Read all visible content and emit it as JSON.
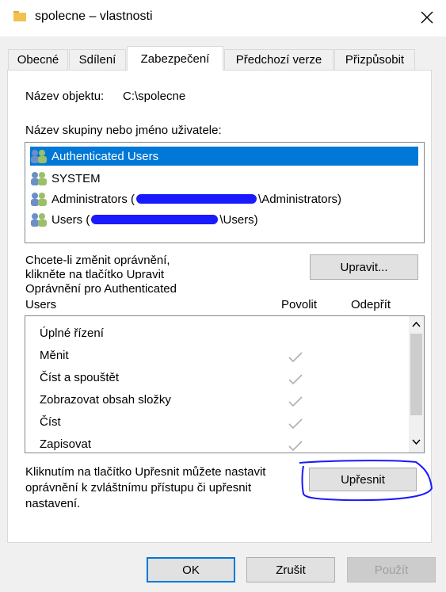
{
  "window": {
    "title": "spolecne – vlastnosti"
  },
  "tabs": [
    {
      "label": "Obecné"
    },
    {
      "label": "Sdílení"
    },
    {
      "label": "Zabezpečení"
    },
    {
      "label": "Předchozí verze"
    },
    {
      "label": "Přizpůsobit"
    }
  ],
  "security": {
    "object_label": "Název objektu:",
    "object_value": "C:\\spolecne",
    "group_label": "Název skupiny nebo jméno uživatele:",
    "users": [
      {
        "name": "Authenticated Users",
        "selected": true
      },
      {
        "name": "SYSTEM"
      },
      {
        "name": "Administrators (",
        "suffix": "\\Administrators)"
      },
      {
        "name": "Users (",
        "suffix": "\\Users)"
      }
    ],
    "change_text_1": "Chcete-li změnit oprávnění,",
    "change_text_2": "klikněte na tlačítko Upravit",
    "edit_button": "Upravit...",
    "perm_title_1": "Oprávnění pro Authenticated",
    "perm_title_2": "Users",
    "col_allow": "Povolit",
    "col_deny": "Odepřít",
    "permissions": [
      {
        "name": "Úplné řízení",
        "allow": false
      },
      {
        "name": "Měnit",
        "allow": true
      },
      {
        "name": "Číst a spouštět",
        "allow": true
      },
      {
        "name": "Zobrazovat obsah složky",
        "allow": true
      },
      {
        "name": "Číst",
        "allow": true
      },
      {
        "name": "Zapisovat",
        "allow": true
      }
    ],
    "advanced_text_1": "Kliknutím na tlačítko Upřesnit můžete nastavit",
    "advanced_text_2": "oprávnění k zvláštnímu přístupu či upřesnit",
    "advanced_text_3": "nastavení.",
    "advanced_button": "Upřesnit"
  },
  "footer": {
    "ok": "OK",
    "cancel": "Zrušit",
    "apply": "Použít"
  },
  "colors": {
    "accent": "#0078d7",
    "annotation": "#1a1aff",
    "check": "#b0b0b0"
  },
  "icons": {
    "folder": "folder-icon",
    "close": "close-icon",
    "user": "users-icon"
  }
}
